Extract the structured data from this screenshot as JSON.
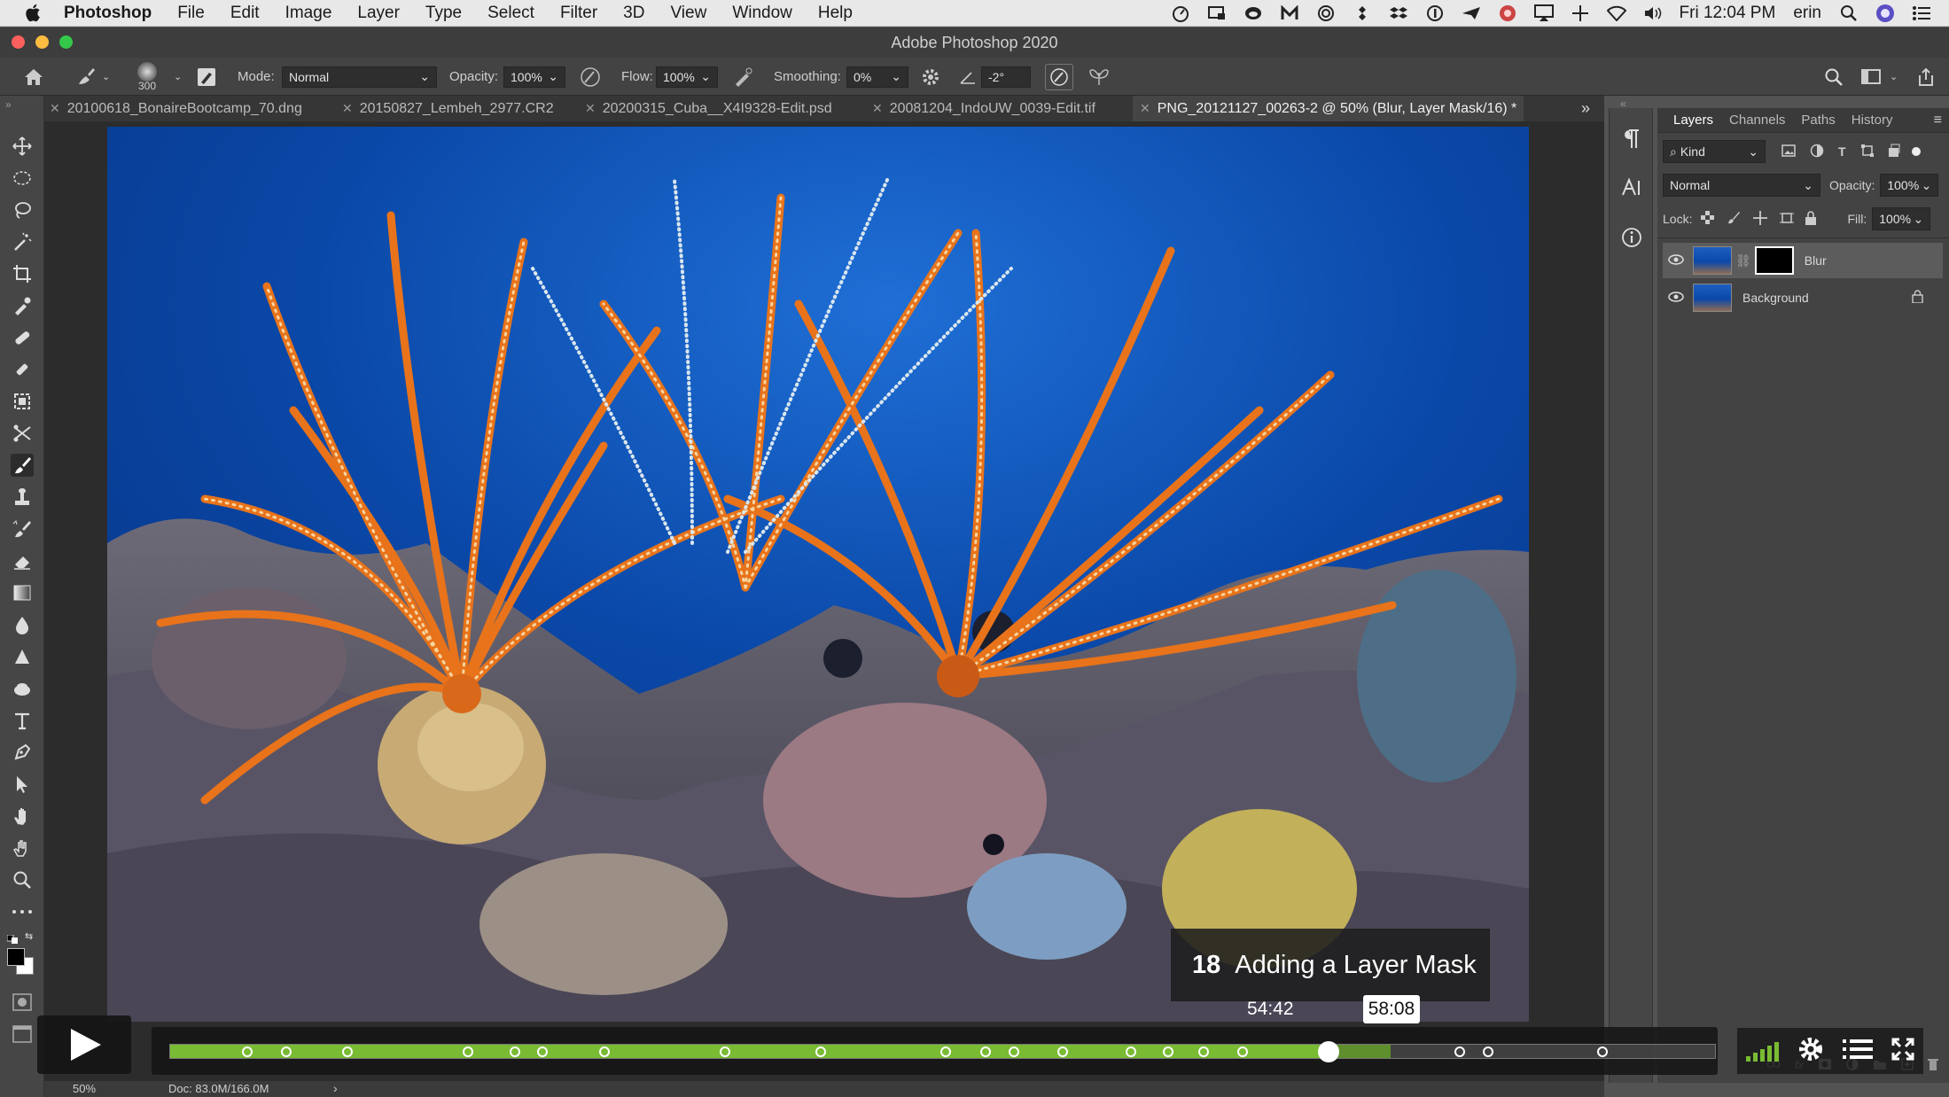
{
  "menubar": {
    "app_name": "Photoshop",
    "items": [
      "File",
      "Edit",
      "Image",
      "Layer",
      "Type",
      "Select",
      "Filter",
      "3D",
      "View",
      "Window",
      "Help"
    ],
    "clock": "Fri 12:04 PM",
    "user": "erin"
  },
  "window": {
    "title": "Adobe Photoshop 2020"
  },
  "options_bar": {
    "brush_size": "300",
    "mode_label": "Mode:",
    "mode_value": "Normal",
    "opacity_label": "Opacity:",
    "opacity_value": "100%",
    "flow_label": "Flow:",
    "flow_value": "100%",
    "smoothing_label": "Smoothing:",
    "smoothing_value": "0%",
    "angle_value": "-2°"
  },
  "tabs": [
    {
      "label": "20100618_BonaireBootcamp_70.dng"
    },
    {
      "label": "20150827_Lembeh_2977.CR2"
    },
    {
      "label": "20200315_Cuba__X4I9328-Edit.psd"
    },
    {
      "label": "20081204_IndoUW_0039-Edit.tif"
    },
    {
      "label": "PNG_20121127_00263-2 @ 50% (Blur, Layer Mask/16) *"
    }
  ],
  "layers_panel": {
    "tabs": [
      "Layers",
      "Channels",
      "Paths",
      "History"
    ],
    "filter_value": "Kind",
    "blend_mode": "Normal",
    "opacity_label": "Opacity:",
    "opacity_value": "100%",
    "lock_label": "Lock:",
    "fill_label": "Fill:",
    "fill_value": "100%",
    "layers": [
      {
        "name": "Blur"
      },
      {
        "name": "Background"
      }
    ]
  },
  "status_bar": {
    "zoom": "50%",
    "doc_info": "Doc: 83.0M/166.0M"
  },
  "video": {
    "chapter_number": "18",
    "chapter_title": "Adding a Layer Mask",
    "current_time": "54:42",
    "hover_time": "58:08",
    "played_fraction": 0.75,
    "buffered_fraction": 0.79,
    "volume_bars": 5,
    "chapter_marks": [
      0.05,
      0.075,
      0.115,
      0.193,
      0.223,
      0.241,
      0.281,
      0.359,
      0.421,
      0.502,
      0.528,
      0.546,
      0.578,
      0.622,
      0.646,
      0.669,
      0.694,
      0.835,
      0.853,
      0.927
    ]
  },
  "colors": {
    "accent_green": "#79bb33",
    "ocean_blue": "#0a48a8",
    "crinoid_orange": "#e8731a"
  }
}
